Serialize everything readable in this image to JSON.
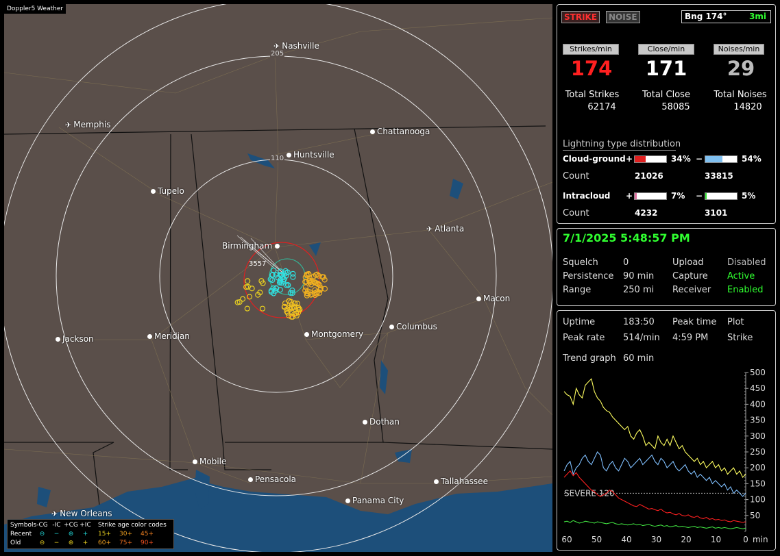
{
  "app": {
    "title": "Doppler5 Weather"
  },
  "map": {
    "range_rings": [
      "205",
      "110"
    ],
    "severe_label": "SEVERE 120",
    "cities": [
      {
        "name": "Nashville",
        "type": "airport"
      },
      {
        "name": "Memphis",
        "type": "airport"
      },
      {
        "name": "Chattanooga",
        "type": "city"
      },
      {
        "name": "Huntsville",
        "type": "city"
      },
      {
        "name": "Tupelo",
        "type": "city"
      },
      {
        "name": "Atlanta",
        "type": "airport"
      },
      {
        "name": "Birmingham",
        "type": "city"
      },
      {
        "name": "Macon",
        "type": "city"
      },
      {
        "name": "Jackson",
        "type": "city"
      },
      {
        "name": "Meridian",
        "type": "city"
      },
      {
        "name": "Montgomery",
        "type": "city"
      },
      {
        "name": "Columbus",
        "type": "city"
      },
      {
        "name": "Dothan",
        "type": "city"
      },
      {
        "name": "Mobile",
        "type": "city"
      },
      {
        "name": "Pensacola",
        "type": "city"
      },
      {
        "name": "Tallahassee",
        "type": "city"
      },
      {
        "name": "Panama City",
        "type": "city"
      },
      {
        "name": "New Orleans",
        "type": "airport"
      }
    ],
    "storm_label": "3557"
  },
  "legend": {
    "row1": [
      "Symbols",
      "-CG",
      "-IC",
      "+CG",
      "+IC",
      "Strike age color codes"
    ],
    "row2": [
      "Recent",
      "⊖",
      "−",
      "⊕",
      "+",
      "15+",
      "30+",
      "45+"
    ],
    "row3": [
      "Old",
      "⊖",
      "−",
      "⊕",
      "+",
      "60+",
      "75+",
      "90+"
    ],
    "colors": {
      "recent": "#20d0d0",
      "old": "#e8d020",
      "age15": "#e8d020",
      "age30": "#f0a020",
      "age45": "#f08020",
      "age60": "#f0a020",
      "age75": "#f07020",
      "age90": "#f05020"
    }
  },
  "status": {
    "strike_tag": "STRIKE",
    "noise_tag": "NOISE",
    "bearing_label": "Bng 174°",
    "bearing_distance": "3mi"
  },
  "rates": {
    "strikes_hdr": "Strikes/min",
    "close_hdr": "Close/min",
    "noises_hdr": "Noises/min",
    "strikes_val": "174",
    "close_val": "171",
    "noises_val": "29",
    "total_strikes_label": "Total Strikes",
    "total_close_label": "Total Close",
    "total_noises_label": "Total Noises",
    "total_strikes": "62174",
    "total_close": "58085",
    "total_noises": "14820"
  },
  "distribution": {
    "title": "Lightning type distribution",
    "cg_label": "Cloud-ground",
    "ic_label": "Intracloud",
    "count_label": "Count",
    "plus": "+",
    "minus": "−",
    "cg_pos_pct": "34%",
    "cg_neg_pct": "54%",
    "ic_pos_pct": "7%",
    "ic_neg_pct": "5%",
    "cg_pos_frac": 0.34,
    "cg_neg_frac": 0.54,
    "ic_pos_frac": 0.07,
    "ic_neg_frac": 0.05,
    "cg_pos_count": "21026",
    "cg_neg_count": "33815",
    "ic_pos_count": "4232",
    "ic_neg_count": "3101",
    "colors": {
      "cg_pos": "#e02020",
      "cg_neg": "#80c0f0",
      "ic_pos": "#e070a0",
      "ic_neg": "#30e030"
    }
  },
  "settings": {
    "datetime": "7/1/2025 5:48:57 PM",
    "squelch_label": "Squelch",
    "squelch": "0",
    "persistence_label": "Persistence",
    "persistence": "90 min",
    "range_label": "Range",
    "range": "250 mi",
    "upload_label": "Upload",
    "upload": "Disabled",
    "capture_label": "Capture",
    "capture": "Active",
    "receiver_label": "Receiver",
    "receiver": "Enabled"
  },
  "stats": {
    "uptime_label": "Uptime",
    "uptime": "183:50",
    "peak_time_label": "Peak time",
    "peak_time": "4:59 PM",
    "plot_label": "Plot",
    "plot": "Strike",
    "peak_rate_label": "Peak rate",
    "peak_rate": "514/min",
    "trend_label": "Trend graph",
    "trend_window": "60 min"
  },
  "chart_data": {
    "type": "line",
    "xlabel": "min",
    "x_ticks": [
      "60",
      "50",
      "40",
      "30",
      "20",
      "10",
      "0"
    ],
    "y_ticks": [
      "500",
      "450",
      "400",
      "350",
      "300",
      "250",
      "200",
      "150",
      "100",
      "50"
    ],
    "xlim": [
      60,
      0
    ],
    "ylim": [
      0,
      500
    ],
    "threshold": {
      "label": "SEVERE 120",
      "value": 120
    },
    "series": [
      {
        "color": "#ffff60",
        "values": [
          440,
          430,
          425,
          400,
          450,
          430,
          420,
          460,
          470,
          480,
          440,
          420,
          410,
          390,
          380,
          375,
          360,
          350,
          340,
          330,
          320,
          330,
          300,
          290,
          310,
          320,
          300,
          270,
          280,
          270,
          260,
          300,
          280,
          270,
          290,
          270,
          300,
          280,
          260,
          270,
          250,
          240,
          230,
          220,
          230,
          210,
          220,
          200,
          210,
          220,
          200,
          210,
          190,
          200,
          180,
          190,
          200,
          180,
          190,
          170,
          180
        ]
      },
      {
        "color": "#80c0ff",
        "values": [
          190,
          210,
          220,
          180,
          200,
          210,
          230,
          240,
          220,
          210,
          230,
          250,
          240,
          200,
          190,
          210,
          220,
          200,
          190,
          210,
          230,
          220,
          200,
          210,
          220,
          230,
          210,
          220,
          230,
          240,
          220,
          210,
          230,
          220,
          200,
          210,
          220,
          200,
          190,
          200,
          210,
          190,
          180,
          190,
          170,
          180,
          170,
          160,
          170,
          150,
          160,
          150,
          140,
          150,
          130,
          140,
          120,
          130,
          120,
          110,
          120
        ]
      },
      {
        "color": "#ff2020",
        "values": [
          170,
          180,
          190,
          175,
          185,
          170,
          160,
          150,
          140,
          130,
          125,
          115,
          110,
          115,
          120,
          130,
          125,
          115,
          105,
          100,
          95,
          90,
          85,
          80,
          78,
          85,
          80,
          75,
          70,
          72,
          68,
          65,
          70,
          62,
          58,
          60,
          55,
          52,
          56,
          50,
          48,
          52,
          46,
          44,
          48,
          42,
          40,
          44,
          38,
          40,
          36,
          38,
          34,
          36,
          32,
          30,
          34,
          32,
          30,
          28,
          30
        ]
      },
      {
        "color": "#40e040",
        "values": [
          30,
          32,
          28,
          34,
          30,
          26,
          28,
          32,
          30,
          28,
          26,
          30,
          28,
          26,
          24,
          26,
          28,
          24,
          22,
          24,
          22,
          20,
          22,
          24,
          20,
          22,
          18,
          20,
          22,
          18,
          16,
          18,
          20,
          16,
          18,
          14,
          16,
          18,
          14,
          16,
          14,
          12,
          14,
          16,
          12,
          14,
          12,
          10,
          12,
          14,
          10,
          12,
          10,
          12,
          10,
          8,
          10,
          12,
          10,
          8,
          10
        ]
      }
    ]
  }
}
